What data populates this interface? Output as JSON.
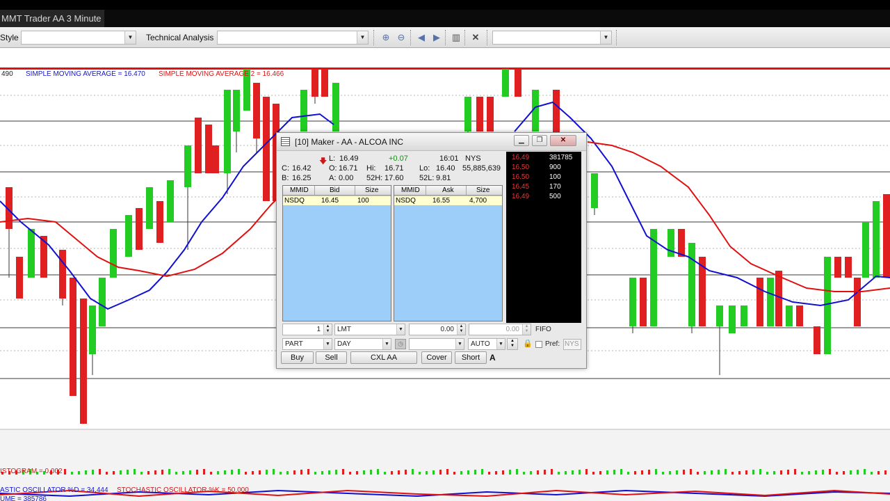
{
  "window": {
    "title": "MMT Trader AA  3 Minute"
  },
  "toolbar": {
    "style_label": "Style",
    "style_value": "",
    "technical_label": "Technical Analysis",
    "technical_value": "",
    "right_combo_value": "",
    "icons": [
      "zoom-in-icon",
      "zoom-out-icon",
      "arrow-left-icon",
      "arrow-right-icon",
      "chart-bars-icon",
      "close-icon"
    ]
  },
  "chart": {
    "price_label": "490",
    "sma1_label": "SIMPLE MOVING AVERAGE = 16.470",
    "sma2_label": "SIMPLE MOVING AVERAGE 2 = 16.466",
    "histogram_label": "ISTOGRAM = 0.002",
    "stoch_d_label": "ASTIC OSCILLATOR %D = 34.444",
    "stoch_k_label": "STOCHASTIC OSCILLATOR %K = 50.000",
    "volume_label": "UME = 385786",
    "colors": {
      "up": "#22cc22",
      "down": "#e02020",
      "sma1": "#1010d0",
      "sma2": "#e01010",
      "topline": "#e01010"
    }
  },
  "level2": {
    "title": "[10]  Maker - AA - ALCOA INC",
    "quote": {
      "last_label": "L:",
      "last": "16.49",
      "change": "+0.07",
      "time": "16:01",
      "exchange": "NYS",
      "close_label": "C:",
      "close": "16.42",
      "open_label": "O:",
      "open": "16.71",
      "high_label": "Hi:",
      "high": "16.71",
      "low_label": "Lo:",
      "low": "16.40",
      "volume": "55,885,639",
      "bid_label": "B:",
      "bid": "16.25",
      "ask_label": "A:",
      "ask": "0.00",
      "high52_label": "52H:",
      "high52": "17.60",
      "low52_label": "52L:",
      "low52": "9.81"
    },
    "bid_book": {
      "headers": [
        "MMID",
        "Bid",
        "Size"
      ],
      "rows": [
        [
          "NSDQ",
          "16.45",
          "100"
        ]
      ]
    },
    "ask_book": {
      "headers": [
        "MMID",
        "Ask",
        "Size"
      ],
      "rows": [
        [
          "NSDQ",
          "16.55",
          "4,700"
        ]
      ]
    },
    "time_sales": [
      [
        "16.49",
        "381785"
      ],
      [
        "16.50",
        "900"
      ],
      [
        "16.50",
        "100"
      ],
      [
        "16.45",
        "170"
      ],
      [
        "16.49",
        "500"
      ]
    ],
    "order": {
      "quantity": "1",
      "order_type": "LMT",
      "price": "0.00",
      "stop_price": "0.00",
      "fifo": "FIFO",
      "fill": "PART",
      "tif": "DAY",
      "route": "",
      "route_mode": "AUTO",
      "pref_label": "Pref:",
      "pref_value": "NYS"
    },
    "buttons": {
      "buy": "Buy",
      "sell": "Sell",
      "cancel": "CXL AA",
      "cover": "Cover",
      "short": "Short",
      "account": "A"
    }
  }
}
